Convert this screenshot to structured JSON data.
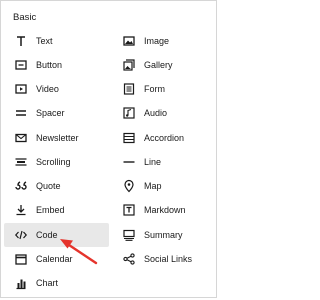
{
  "panel": {
    "section_title": "Basic",
    "accent_color": "#e5342c",
    "highlighted_item": "Code"
  },
  "left_items": [
    {
      "label": "Text",
      "icon": "text-icon"
    },
    {
      "label": "Button",
      "icon": "button-icon"
    },
    {
      "label": "Video",
      "icon": "video-icon"
    },
    {
      "label": "Spacer",
      "icon": "spacer-icon"
    },
    {
      "label": "Newsletter",
      "icon": "newsletter-icon"
    },
    {
      "label": "Scrolling",
      "icon": "scrolling-icon"
    },
    {
      "label": "Quote",
      "icon": "quote-icon"
    },
    {
      "label": "Embed",
      "icon": "embed-icon"
    },
    {
      "label": "Code",
      "icon": "code-icon"
    },
    {
      "label": "Calendar",
      "icon": "calendar-icon"
    },
    {
      "label": "Chart",
      "icon": "chart-icon"
    }
  ],
  "right_items": [
    {
      "label": "Image",
      "icon": "image-icon"
    },
    {
      "label": "Gallery",
      "icon": "gallery-icon"
    },
    {
      "label": "Form",
      "icon": "form-icon"
    },
    {
      "label": "Audio",
      "icon": "audio-icon"
    },
    {
      "label": "Accordion",
      "icon": "accordion-icon"
    },
    {
      "label": "Line",
      "icon": "line-icon"
    },
    {
      "label": "Map",
      "icon": "map-icon"
    },
    {
      "label": "Markdown",
      "icon": "markdown-icon"
    },
    {
      "label": "Summary",
      "icon": "summary-icon"
    },
    {
      "label": "Social Links",
      "icon": "social-links-icon"
    }
  ]
}
